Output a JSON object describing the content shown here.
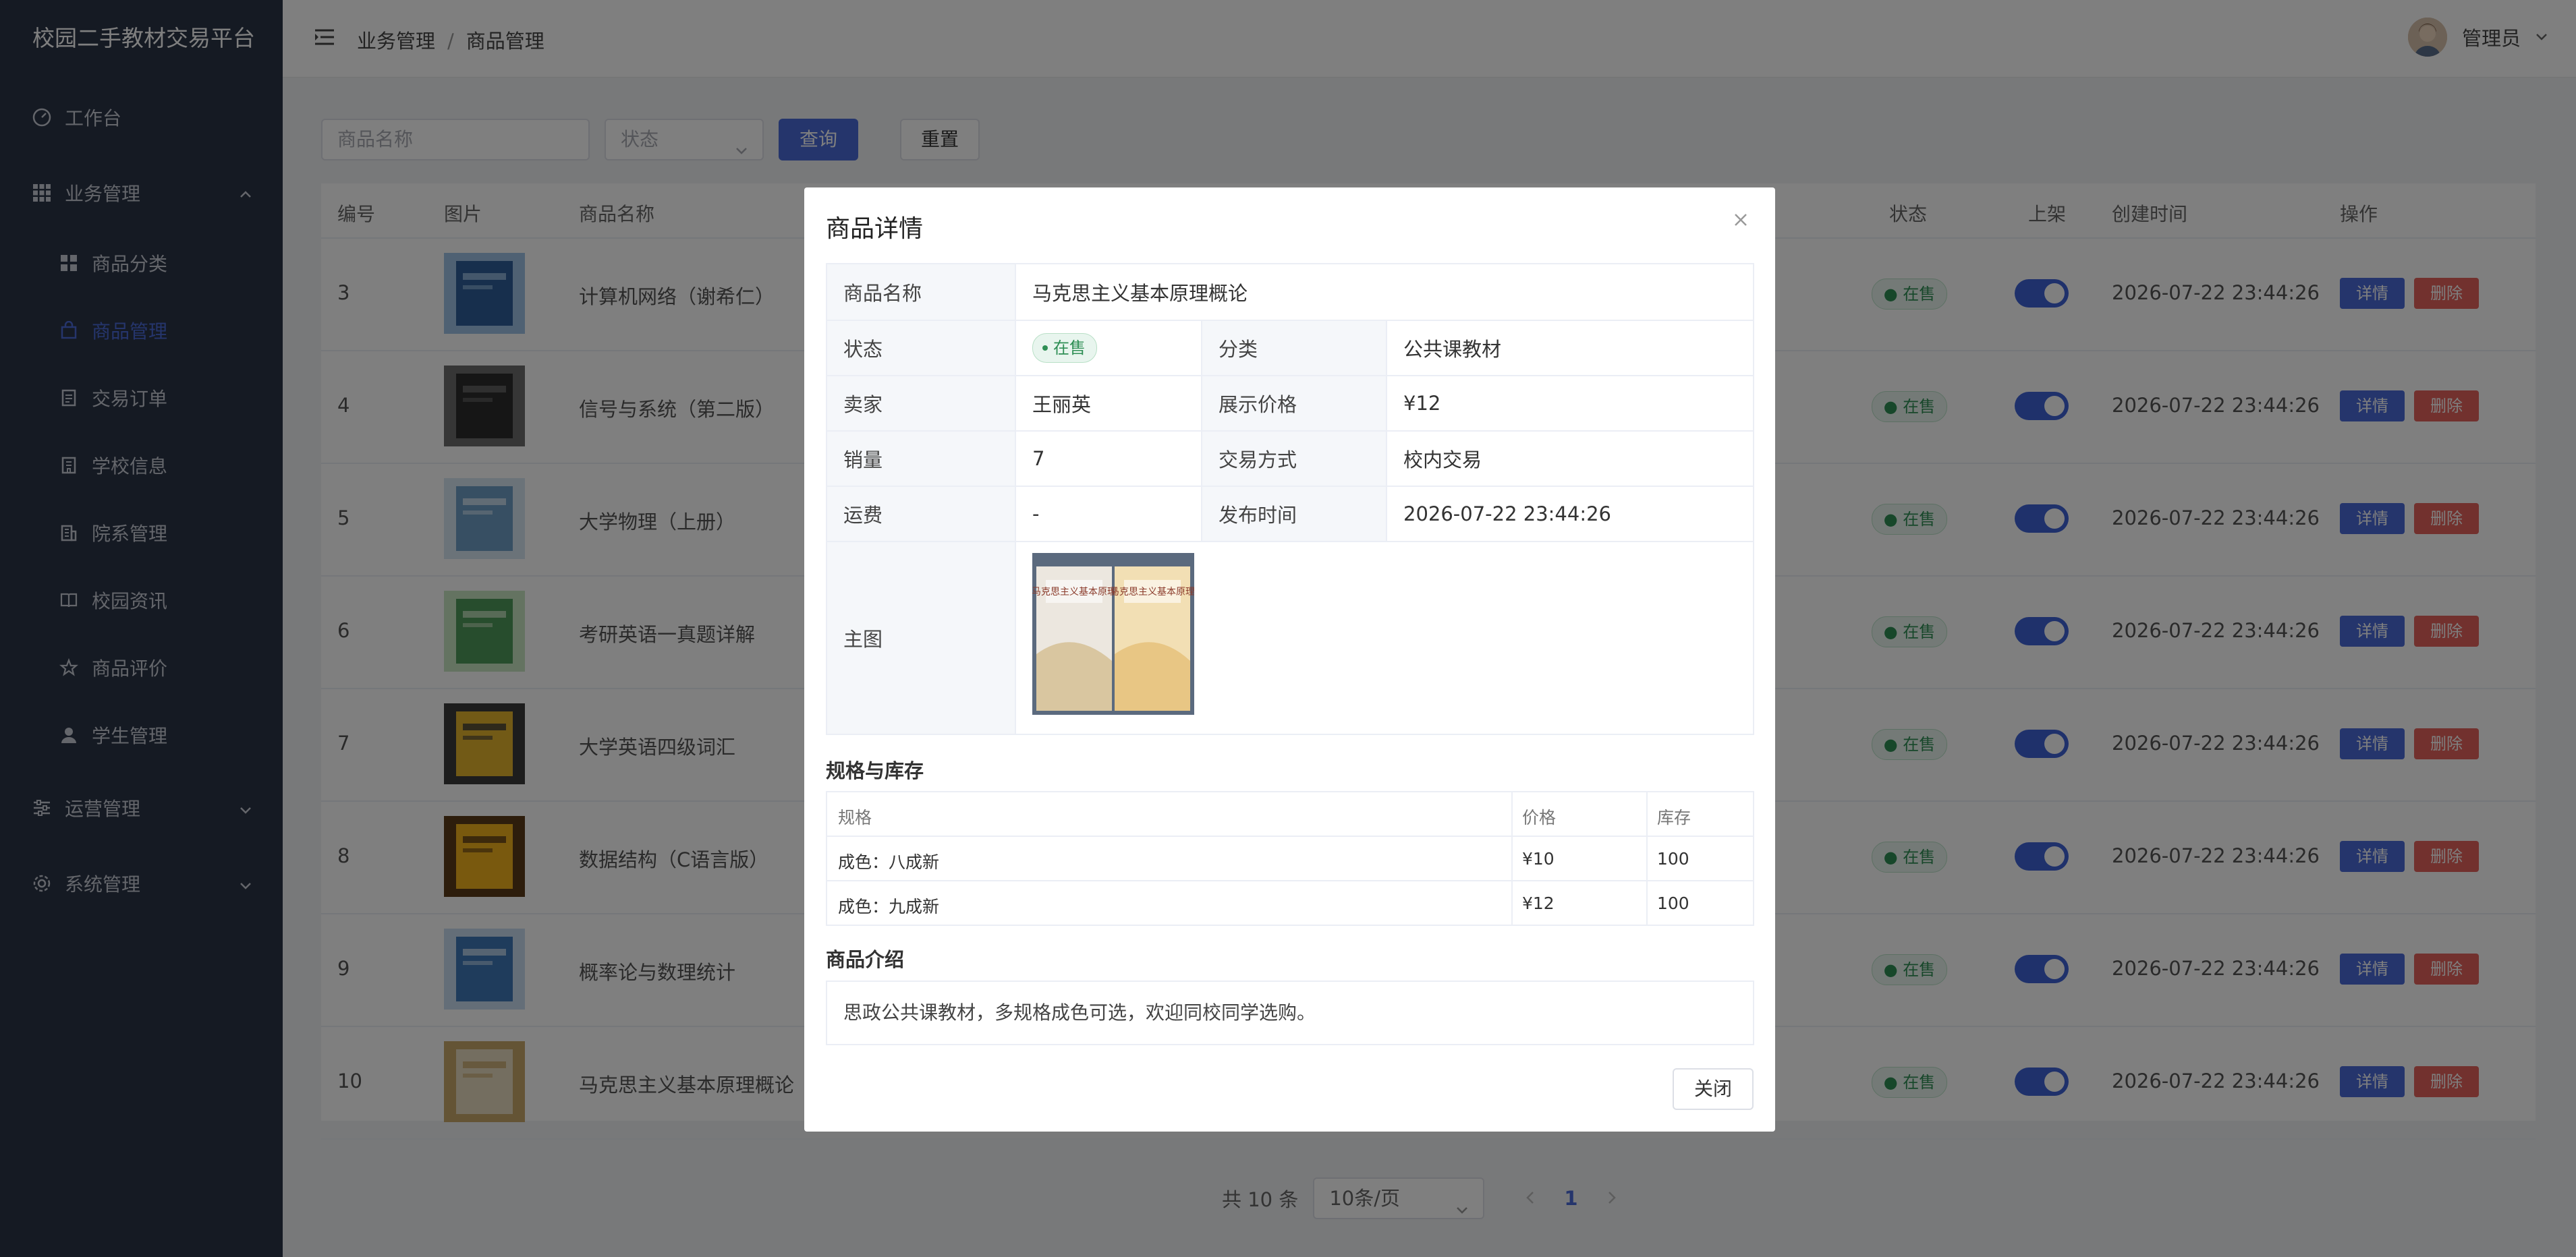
{
  "app": {
    "title": "校园二手教材交易平台"
  },
  "sidebar": {
    "items": [
      {
        "label": "工作台",
        "icon": "dashboard-icon"
      },
      {
        "label": "业务管理",
        "icon": "grid-icon"
      },
      {
        "label": "商品分类",
        "icon": "category-icon"
      },
      {
        "label": "商品管理",
        "icon": "bag-icon"
      },
      {
        "label": "交易订单",
        "icon": "order-icon"
      },
      {
        "label": "学校信息",
        "icon": "school-icon"
      },
      {
        "label": "院系管理",
        "icon": "building-icon"
      },
      {
        "label": "校园资讯",
        "icon": "book-icon"
      },
      {
        "label": "商品评价",
        "icon": "star-icon"
      },
      {
        "label": "学生管理",
        "icon": "user-icon"
      },
      {
        "label": "运营管理",
        "icon": "sliders-icon"
      },
      {
        "label": "系统管理",
        "icon": "gear-icon"
      }
    ]
  },
  "header": {
    "breadcrumb": [
      "业务管理",
      "商品管理"
    ],
    "user": "管理员"
  },
  "search": {
    "name_placeholder": "商品名称",
    "status_placeholder": "状态",
    "query_label": "查询",
    "reset_label": "重置"
  },
  "table": {
    "columns": [
      "编号",
      "图片",
      "商品名称",
      "状态",
      "上架",
      "创建时间",
      "操作"
    ],
    "rows": [
      {
        "id": "3",
        "name": "计算机网络（谢希仁）",
        "status": "在售",
        "created": "2026-07-22 23:44:26"
      },
      {
        "id": "4",
        "name": "信号与系统（第二版）",
        "status": "在售",
        "created": "2026-07-22 23:44:26"
      },
      {
        "id": "5",
        "name": "大学物理（上册）",
        "status": "在售",
        "created": "2026-07-22 23:44:26"
      },
      {
        "id": "6",
        "name": "考研英语一真题详解",
        "status": "在售",
        "created": "2026-07-22 23:44:26"
      },
      {
        "id": "7",
        "name": "大学英语四级词汇",
        "status": "在售",
        "created": "2026-07-22 23:44:26"
      },
      {
        "id": "8",
        "name": "数据结构（C语言版）",
        "status": "在售",
        "created": "2026-07-22 23:44:26"
      },
      {
        "id": "9",
        "name": "概率论与数理统计",
        "status": "在售",
        "created": "2026-07-22 23:44:26"
      },
      {
        "id": "10",
        "name": "马克思主义基本原理概论",
        "status": "在售",
        "created": "2026-07-22 23:44:26"
      }
    ],
    "detail_label": "详情",
    "delete_label": "删除"
  },
  "pagination": {
    "total": "共 10 条",
    "page_size": "10条/页",
    "current": "1"
  },
  "modal": {
    "title": "商品详情",
    "fields": {
      "name_label": "商品名称",
      "name_value": "马克思主义基本原理概论",
      "status_label": "状态",
      "status_value": "在售",
      "category_label": "分类",
      "category_value": "公共课教材",
      "seller_label": "卖家",
      "seller_value": "王丽英",
      "price_label": "展示价格",
      "price_value": "¥12",
      "sales_label": "销量",
      "sales_value": "7",
      "trade_label": "交易方式",
      "trade_value": "校内交易",
      "shipping_label": "运费",
      "shipping_value": "-",
      "publish_label": "发布时间",
      "publish_value": "2026-07-22 23:44:26",
      "image_label": "主图",
      "image_book_text": "马克思主义基本原理"
    },
    "spec_title": "规格与库存",
    "spec_columns": [
      "规格",
      "价格",
      "库存"
    ],
    "specs": [
      {
        "spec": "成色：八成新",
        "price": "¥10",
        "stock": "100"
      },
      {
        "spec": "成色：九成新",
        "price": "¥12",
        "stock": "100"
      }
    ],
    "intro_title": "商品介绍",
    "intro_text": "思政公共课教材，多规格成色可选，欢迎同校同学选购。",
    "close_label": "关闭"
  },
  "colors": {
    "accent": "#4b6bd8",
    "danger": "#e5635c",
    "sidebar_bg": "#2b3447",
    "success": "#2f8f55"
  }
}
